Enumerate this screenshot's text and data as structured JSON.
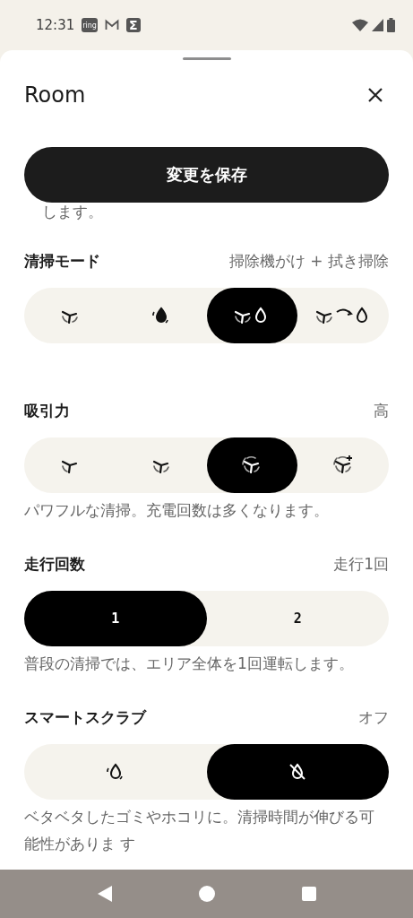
{
  "status_bar": {
    "time": "12:31",
    "notifications": [
      {
        "kind": "text-badge",
        "text": "ring"
      },
      {
        "kind": "mail"
      },
      {
        "kind": "text-badge",
        "text": "Σ"
      }
    ]
  },
  "sheet": {
    "title": "Room",
    "save_button": "変更を保存",
    "cut_text": "します。"
  },
  "sections": [
    {
      "title": "清掃モード",
      "value": "掃除機がけ + 拭き掃除",
      "kind": "icons",
      "options": [
        {
          "kind": "vacuum",
          "selected": false
        },
        {
          "kind": "mop",
          "selected": false
        },
        {
          "kind": "vacuum-mop",
          "selected": true
        },
        {
          "kind": "vacuum-then-mop",
          "selected": false
        }
      ]
    },
    {
      "title": "吸引力",
      "value": "高",
      "kind": "icons",
      "options": [
        {
          "kind": "suction-1",
          "selected": false
        },
        {
          "kind": "suction-2",
          "selected": false
        },
        {
          "kind": "suction-3",
          "selected": true
        },
        {
          "kind": "suction-max",
          "selected": false
        }
      ],
      "description": "パワフルな清掃。充電回数は多くなります。"
    },
    {
      "title": "走行回数",
      "value": "走行1回",
      "kind": "labels",
      "options": [
        {
          "label": "1",
          "selected": true
        },
        {
          "label": "2",
          "selected": false
        }
      ],
      "description": "普段の清掃では、エリア全体を1回運転します。"
    },
    {
      "title": "スマートスクラブ",
      "value": "オフ",
      "kind": "icons",
      "options": [
        {
          "kind": "scrub-on",
          "selected": false
        },
        {
          "kind": "scrub-off",
          "selected": true
        }
      ],
      "description": "ベタベタしたゴミやホコリに。清掃時間が伸びる可能性がありま す"
    }
  ]
}
